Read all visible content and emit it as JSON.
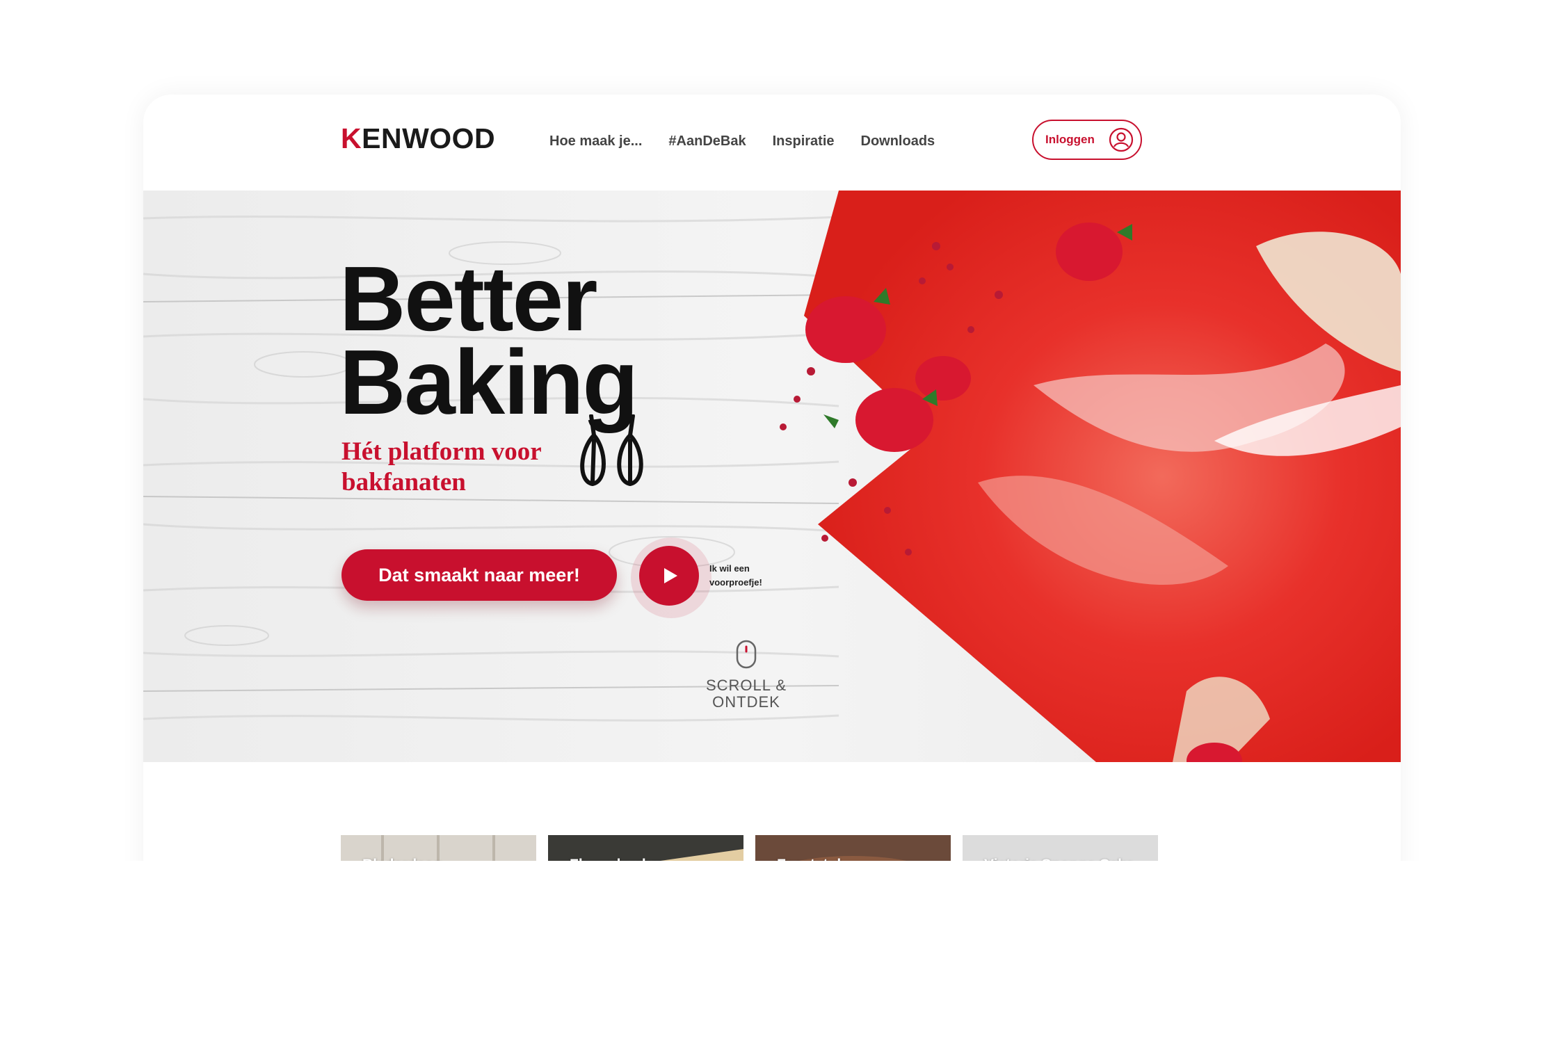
{
  "brand": {
    "logo_first": "K",
    "logo_rest": "ENWOOD"
  },
  "nav": {
    "items": [
      {
        "label": "Hoe maak je..."
      },
      {
        "label": "#AanDeBak"
      },
      {
        "label": "Inspiratie"
      },
      {
        "label": "Downloads"
      }
    ]
  },
  "login": {
    "label": "Inloggen",
    "icon": "user-circle-icon"
  },
  "hero": {
    "title_line1": "Better",
    "title_line2": "Baking",
    "subtitle": "Hét platform voor bakfanaten",
    "cta_label": "Dat smaakt naar meer!",
    "video_label": "Ik wil een voorproefje!",
    "scroll_label": "SCROLL & ONTDEK"
  },
  "cards": [
    {
      "label": "Bladerdeeg"
    },
    {
      "label": "Flammkuchen"
    },
    {
      "label": "Feeststol"
    },
    {
      "label": "Victoria Sponge Cake"
    }
  ],
  "colors": {
    "brand_red": "#c8102e",
    "text_dark": "#111111"
  }
}
